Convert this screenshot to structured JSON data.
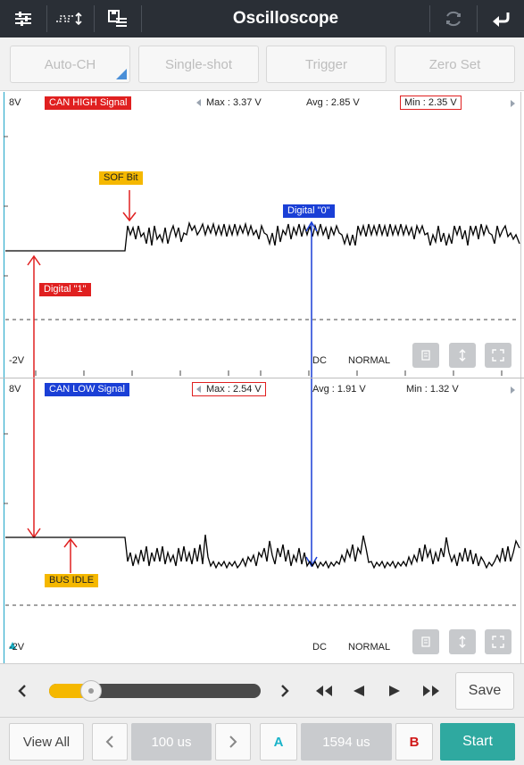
{
  "header": {
    "title": "Oscilloscope"
  },
  "toolbar": {
    "buttons": [
      "Auto-CH",
      "Single-shot",
      "Trigger",
      "Zero Set"
    ]
  },
  "channel1": {
    "scale_top": "8V",
    "scale_bottom": "-2V",
    "signal_name": "CAN HIGH Signal",
    "max": "Max : 3.37 V",
    "avg": "Avg : 2.85 V",
    "min": "Min : 2.35 V",
    "coupling": "DC",
    "mode": "NORMAL",
    "annotations": {
      "sof": "SOF Bit",
      "digital0": "Digital \"0\"",
      "digital1": "Digital \"1\""
    }
  },
  "channel2": {
    "scale_top": "8V",
    "scale_bottom": "-2V",
    "signal_name": "CAN LOW Signal",
    "max": "Max : 2.54 V",
    "avg": "Avg : 1.91 V",
    "min": "Min : 1.32 V",
    "coupling": "DC",
    "mode": "NORMAL",
    "annotations": {
      "bus_idle": "BUS IDLE"
    }
  },
  "playback": {
    "save_label": "Save",
    "slider_position": 0.2
  },
  "footer": {
    "view_all": "View All",
    "timebase": "100 us",
    "cursor_a": "A",
    "cursor_delta": "1594 us",
    "cursor_b": "B",
    "start": "Start"
  },
  "colors": {
    "header_bg": "#2a2f36",
    "ch1_tag": "#e02020",
    "ch2_tag": "#1a3fd6",
    "sof_tag": "#f5b800",
    "start_btn": "#2fa9a0",
    "cursor_a": "#19b3c9",
    "cursor_b": "#d01818"
  }
}
